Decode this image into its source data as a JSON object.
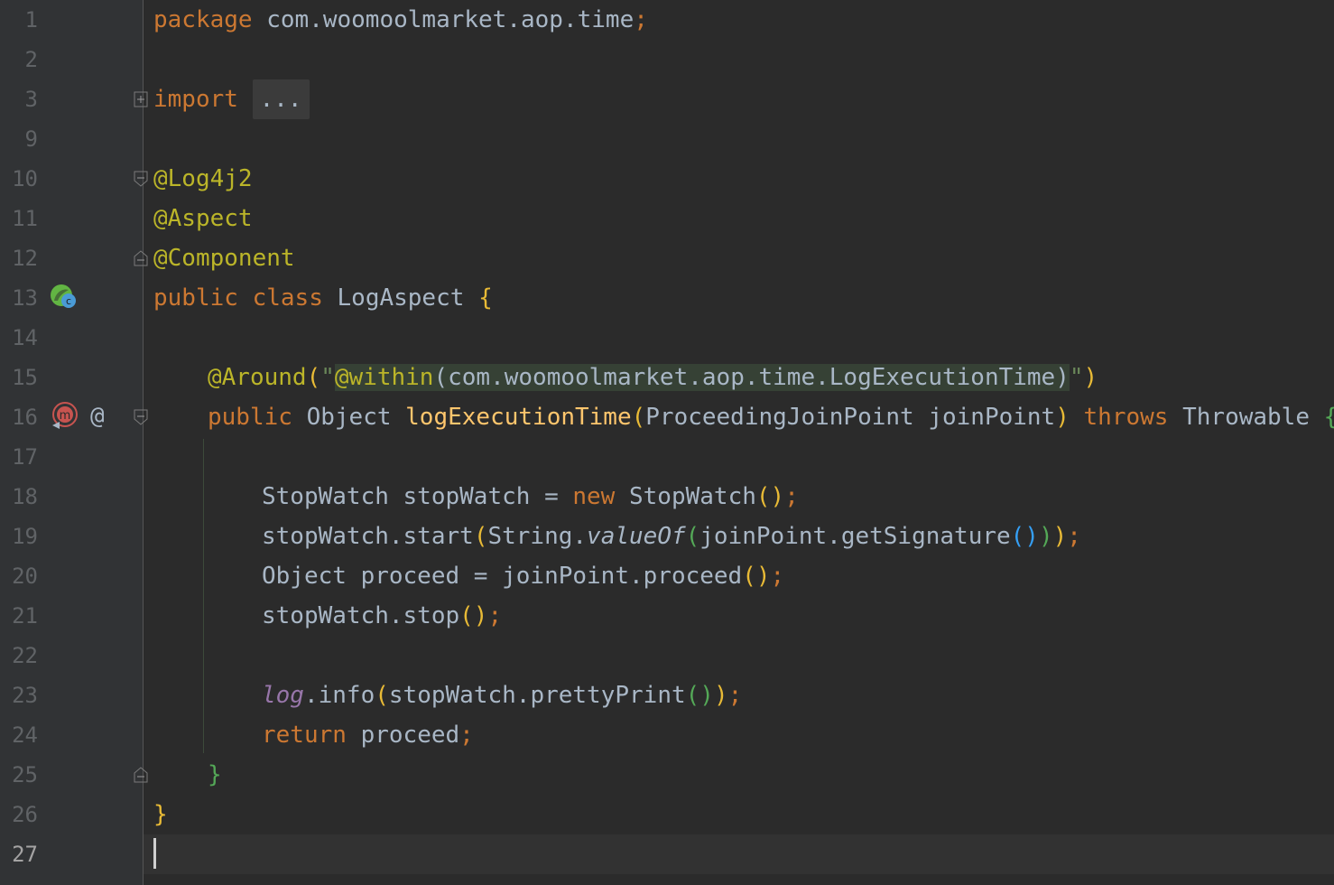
{
  "editor": {
    "language": "Java",
    "current_line": "27",
    "lines": [
      {
        "n": "1"
      },
      {
        "n": "2"
      },
      {
        "n": "3"
      },
      {
        "n": "9"
      },
      {
        "n": "10"
      },
      {
        "n": "11"
      },
      {
        "n": "12"
      },
      {
        "n": "13"
      },
      {
        "n": "14"
      },
      {
        "n": "15"
      },
      {
        "n": "16"
      },
      {
        "n": "17"
      },
      {
        "n": "18"
      },
      {
        "n": "19"
      },
      {
        "n": "20"
      },
      {
        "n": "21"
      },
      {
        "n": "22"
      },
      {
        "n": "23"
      },
      {
        "n": "24"
      },
      {
        "n": "25"
      },
      {
        "n": "26"
      },
      {
        "n": "27"
      }
    ],
    "code": {
      "l1": {
        "kw": "package",
        "rest": " com.woomoolmarket.aop.time",
        "semi": ";"
      },
      "l3": {
        "kw": "import",
        "folded": "..."
      },
      "l10": {
        "ann": "@Log4j2"
      },
      "l11": {
        "ann": "@Aspect"
      },
      "l12": {
        "ann": "@Component"
      },
      "l13": {
        "kw1": "public",
        "kw2": "class",
        "name": "LogAspect",
        "brace": "{"
      },
      "l15": {
        "ann": "@Around",
        "open": "(",
        "quote1": "\"",
        "within": "@within",
        "expr": "(com.woomoolmarket.aop.time.LogExecutionTime)",
        "quote2": "\"",
        "close": ")"
      },
      "l16": {
        "kw": "public",
        "type": "Object",
        "method": "logExecutionTime",
        "open": "(",
        "param": "ProceedingJoinPoint joinPoint",
        "close": ")",
        "throws": "throws",
        "exc": "Throwable",
        "brace": "{"
      },
      "l18": {
        "a": "StopWatch stopWatch = ",
        "kw": "new",
        "b": " StopWatch",
        "parens": "()",
        "semi": ";"
      },
      "l19": {
        "a": "stopWatch.start",
        "p1o": "(",
        "b": "String.",
        "valueOf": "valueOf",
        "p2o": "(",
        "c": "joinPoint.getSignature",
        "p3": "()",
        "p2c": ")",
        "p1c": ")",
        "semi": ";"
      },
      "l20": {
        "a": "Object proceed = joinPoint.proceed",
        "parens": "()",
        "semi": ";"
      },
      "l21": {
        "a": "stopWatch.stop",
        "parens": "()",
        "semi": ";"
      },
      "l23": {
        "log": "log",
        "a": ".info",
        "p1o": "(",
        "b": "stopWatch.prettyPrint",
        "p2": "()",
        "p1c": ")",
        "semi": ";"
      },
      "l24": {
        "kw": "return",
        "a": " proceed",
        "semi": ";"
      },
      "l25": {
        "brace": "}"
      },
      "l26": {
        "brace": "}"
      }
    },
    "gutter_icons": {
      "line13": "spring-bean-icon",
      "line16a": "method-advice-icon",
      "line16b": "@"
    },
    "colors": {
      "background": "#2b2b2b",
      "keyword": "#cc7832",
      "annotation": "#bbb529",
      "string": "#6a8759",
      "method": "#ffc66d",
      "field": "#9876aa",
      "text": "#a9b7c6",
      "line_number": "#606366"
    }
  }
}
